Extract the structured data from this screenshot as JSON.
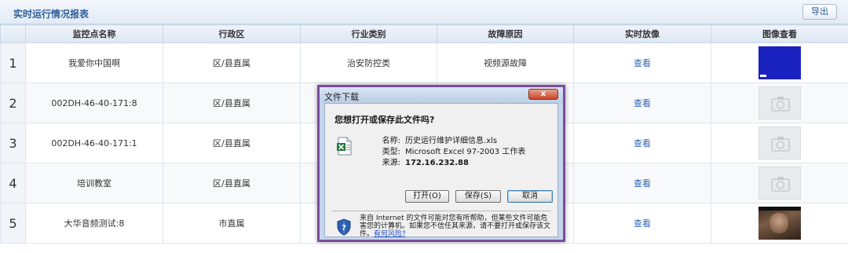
{
  "panel": {
    "title": "实时运行情况报表",
    "export_label": "导出"
  },
  "table": {
    "headers": [
      "",
      "监控点名称",
      "行政区",
      "行业类别",
      "故障原因",
      "实时放像",
      "图像查看"
    ],
    "rows": [
      {
        "index": "1",
        "name": "我爱你中国啊",
        "district": "区/县直属",
        "industry": "治安防控类",
        "reason": "视频源故障",
        "view": "查看",
        "thumb": "blue-frame"
      },
      {
        "index": "2",
        "name": "002DH-46-40-171:8",
        "district": "区/县直属",
        "industry": "",
        "reason": "",
        "view": "查看",
        "thumb": "no-image"
      },
      {
        "index": "3",
        "name": "002DH-46-40-171:1",
        "district": "区/县直属",
        "industry": "",
        "reason": "",
        "view": "查看",
        "thumb": "no-image"
      },
      {
        "index": "4",
        "name": "培训教室",
        "district": "区/县直属",
        "industry": "",
        "reason": "",
        "view": "查看",
        "thumb": "no-image"
      },
      {
        "index": "5",
        "name": "大华音频测试:8",
        "district": "市直属",
        "industry": "",
        "reason": "",
        "view": "查看",
        "thumb": "video-frame"
      }
    ]
  },
  "dialog": {
    "title": "文件下载",
    "close_label": "x",
    "question": "您想打开或保存此文件吗?",
    "name_label": "名称:",
    "name_value": "历史运行维护详细信息.xls",
    "type_label": "类型:",
    "type_value": "Microsoft Excel 97-2003 工作表",
    "from_label": "来源:",
    "from_value": "172.16.232.88",
    "open_label": "打开(O)",
    "save_label": "保存(S)",
    "cancel_label": "取消",
    "warning_text": "来自 Internet 的文件可能对您有所帮助，但某些文件可能危害您的计算机。如果您不信任其来源，请不要打开或保存该文件。",
    "risk_link": "有何风险?"
  },
  "colors": {
    "accent": "#2f5f9a",
    "link": "#2a63b8",
    "dialog_border": "#7b4c9e"
  }
}
